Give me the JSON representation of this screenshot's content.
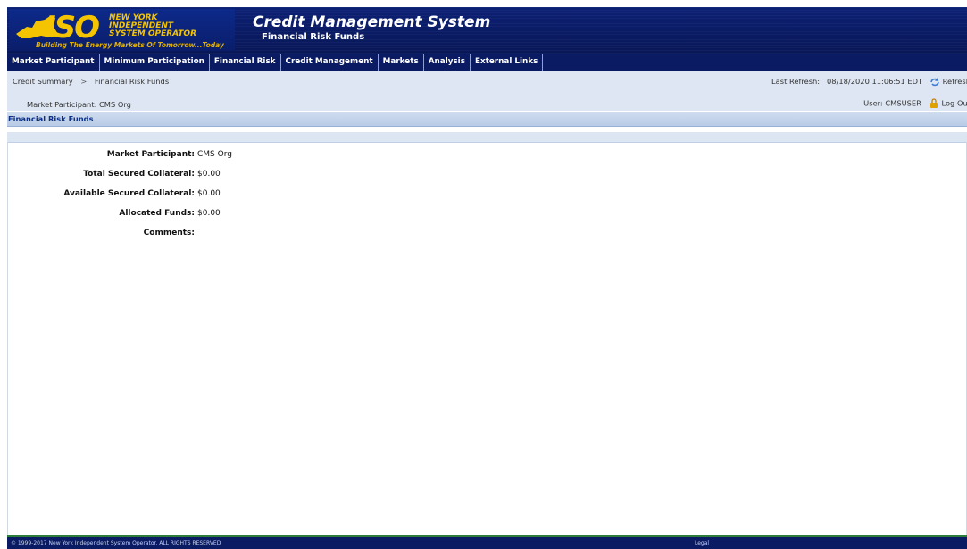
{
  "header": {
    "logo_text": "ISO",
    "logo_lines": [
      "NEW YORK",
      "INDEPENDENT",
      "SYSTEM OPERATOR"
    ],
    "logo_tagline": "Building The Energy Markets Of Tomorrow...Today",
    "app_title": "Credit Management System",
    "page_subtitle": "Financial Risk Funds"
  },
  "menu": {
    "items": [
      {
        "label": "Market Participant"
      },
      {
        "label": "Minimum Participation"
      },
      {
        "label": "Financial Risk"
      },
      {
        "label": "Credit Management"
      },
      {
        "label": "Markets"
      },
      {
        "label": "Analysis"
      },
      {
        "label": "External Links"
      }
    ]
  },
  "breadcrumb": {
    "items": [
      "Credit Summary",
      "Financial Risk Funds"
    ],
    "separator": ">"
  },
  "status": {
    "last_refresh_label": "Last Refresh:",
    "last_refresh_value": "08/18/2020 11:06:51 EDT",
    "refresh_label": "Refresh",
    "market_participant": "Market Participant: CMS Org",
    "user": "User: CMSUSER",
    "logout_label": "Log Out"
  },
  "section": {
    "title": "Financial Risk Funds"
  },
  "fields": [
    {
      "label": "Market Participant:",
      "value": "CMS Org"
    },
    {
      "label": "Total Secured Collateral:",
      "value": "$0.00"
    },
    {
      "label": "Available Secured Collateral:",
      "value": "$0.00"
    },
    {
      "label": "Allocated Funds:",
      "value": "$0.00"
    },
    {
      "label": "Comments:",
      "value": ""
    }
  ],
  "footer": {
    "copyright": "© 1999-2017 New York Independent System Operator. ALL RIGHTS RESERVED",
    "legal": "Legal"
  },
  "colors": {
    "header_bg": "#0a1b64",
    "logo_yellow": "#f5c400",
    "section_title": "#0b2f8a",
    "crumb_bg": "#dde6f2",
    "footer_accent": "#2f7d3a"
  }
}
